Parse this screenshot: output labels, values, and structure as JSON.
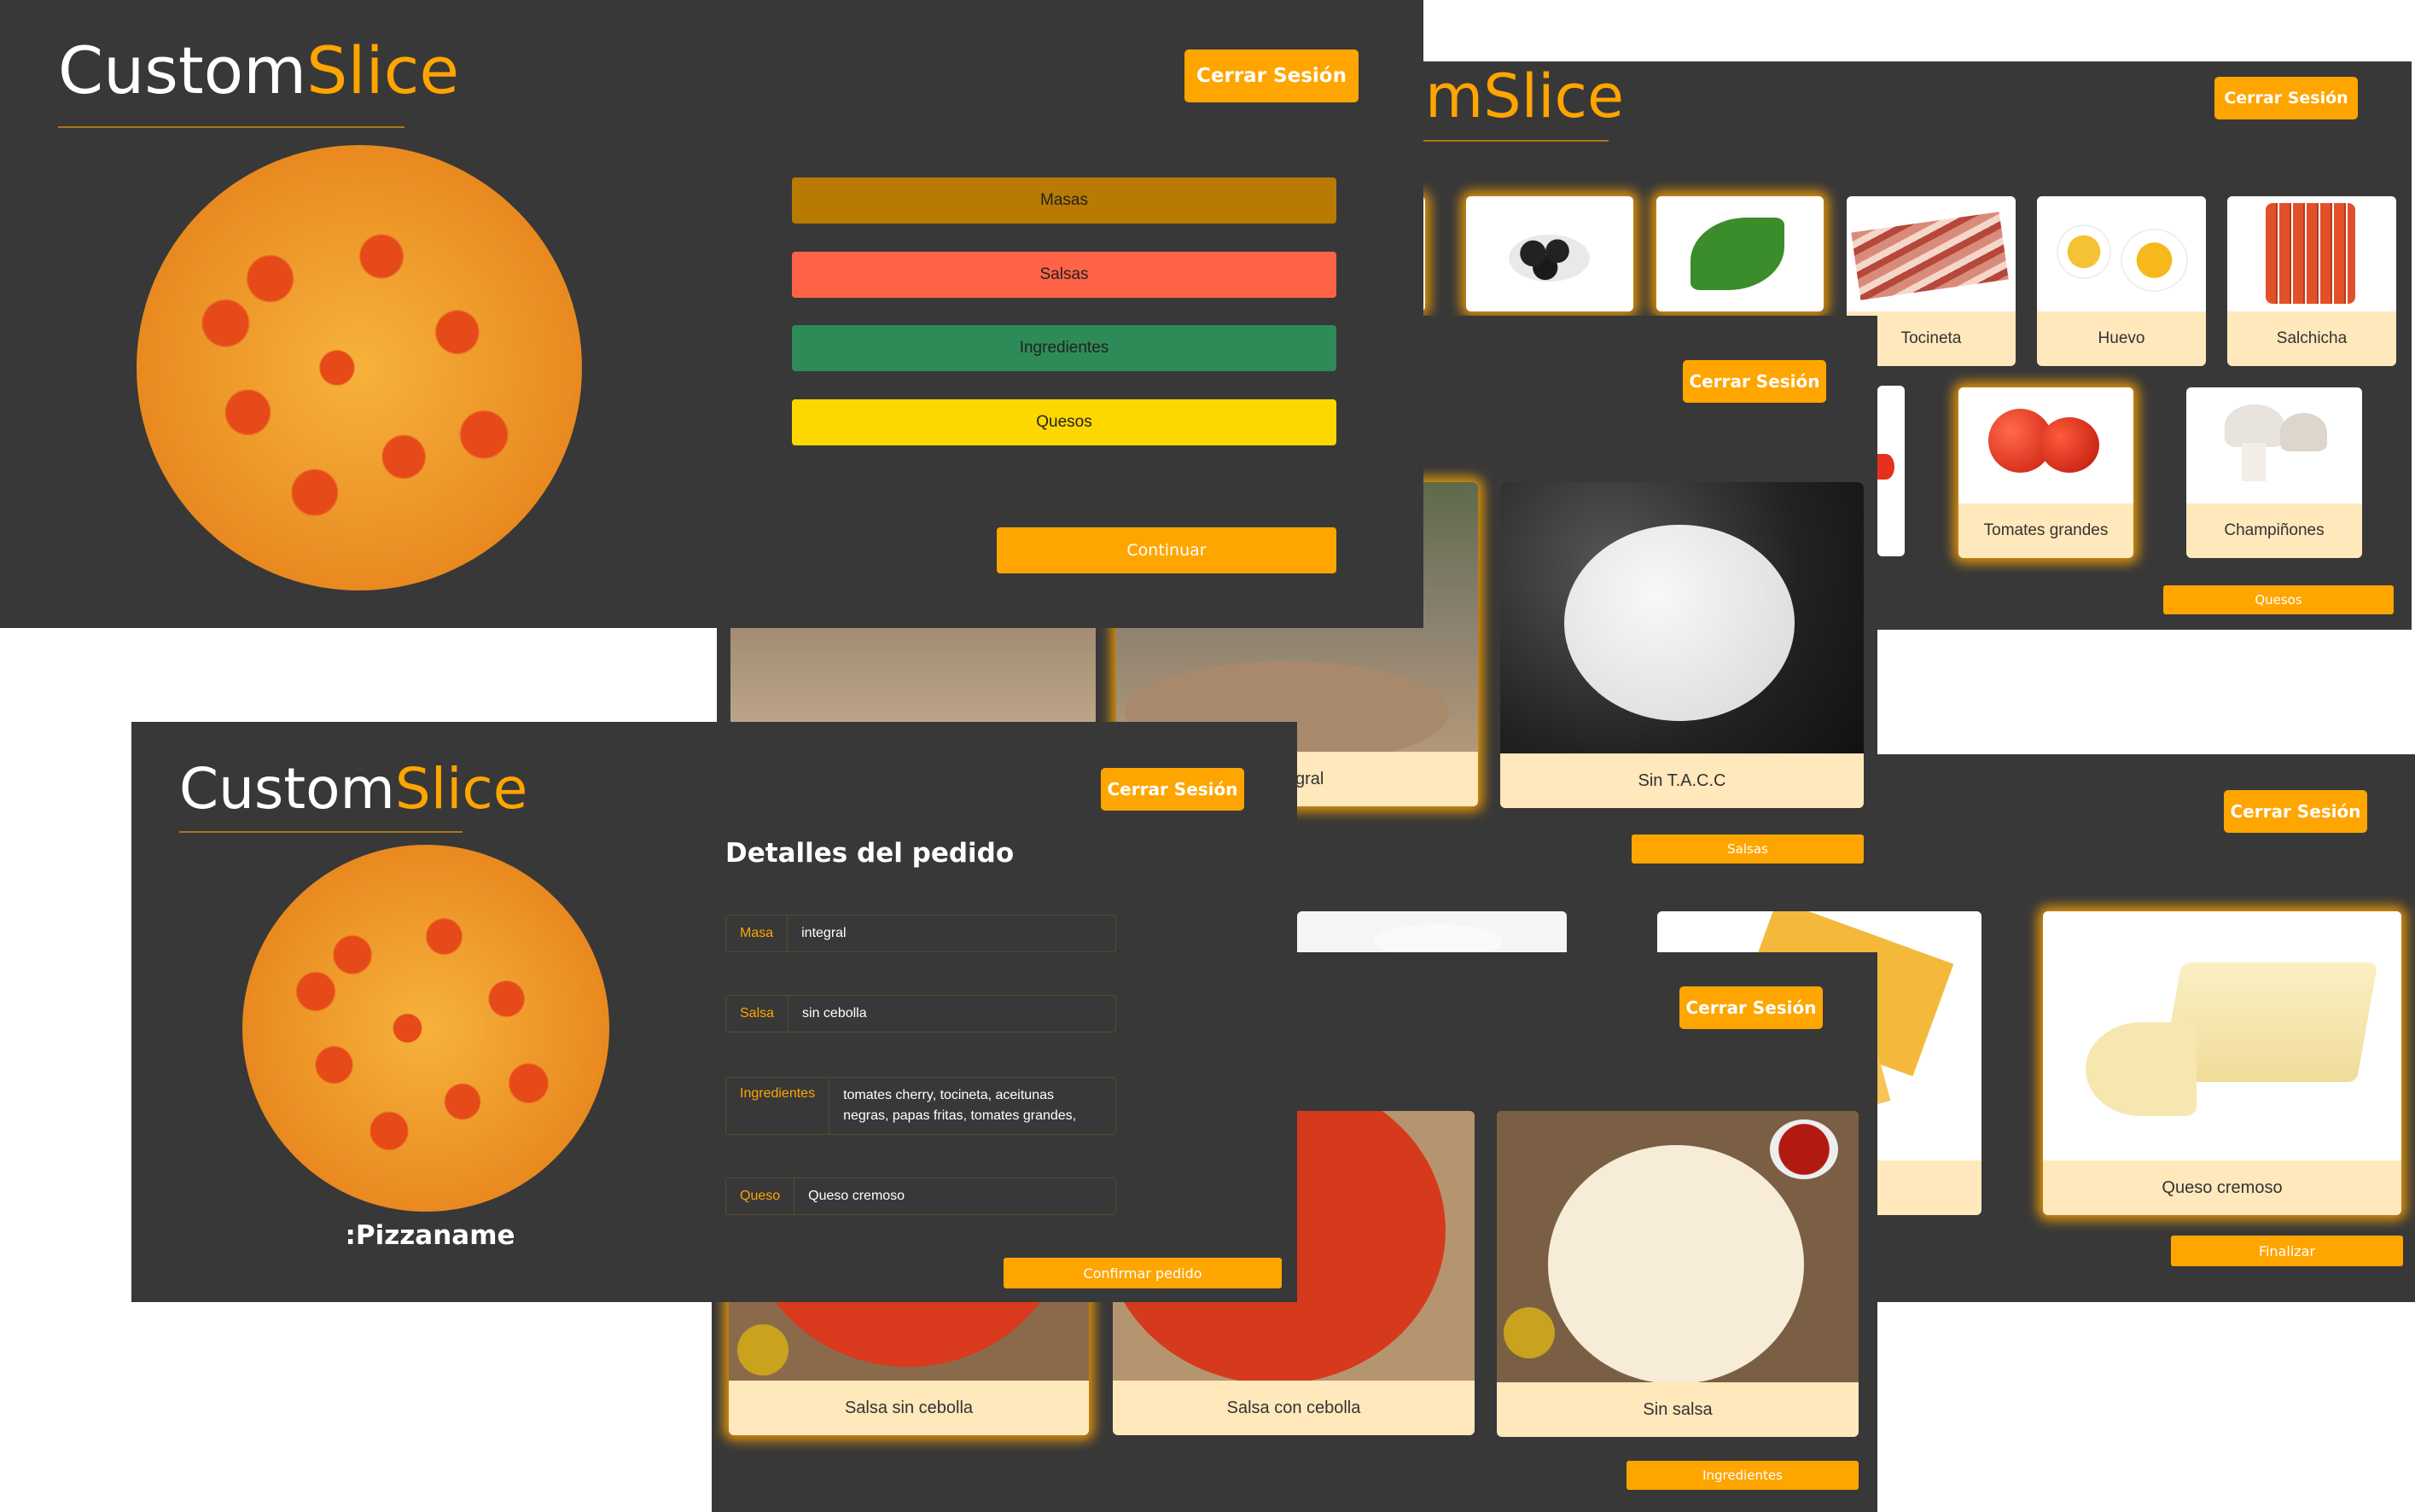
{
  "brand": {
    "part1": "Custom",
    "part2": "Slice",
    "part2_cut": "mSlice"
  },
  "common": {
    "logout_label": "Cerrar Sesión"
  },
  "ingredients_screen": {
    "items": [
      "Tocineta",
      "Huevo",
      "Salchicha",
      "Tomates grandes",
      "Champiñones"
    ],
    "next_label": "Quesos"
  },
  "home_screen": {
    "categories": [
      "Masas",
      "Salsas",
      "Ingredientes",
      "Quesos"
    ],
    "continue_label": "Continuar",
    "colors": {
      "masas": "#b87a00",
      "salsas": "#ff6347",
      "ingredientes": "#2e8b57",
      "quesos": "#ffd700"
    }
  },
  "dough_screen": {
    "items": [
      "gral",
      "Sin T.A.C.C"
    ],
    "next_label": "Salsas"
  },
  "cheese_screen": {
    "items": [
      "Queso cremoso"
    ],
    "next_label": "Finalizar"
  },
  "sauce_screen": {
    "items": [
      "Salsa sin cebolla",
      "Salsa con cebolla",
      "Sin salsa"
    ],
    "next_label": "Ingredientes"
  },
  "order_screen": {
    "title": "Detalles del pedido",
    "pizza_name": ":Pizzaname",
    "fields": [
      {
        "key": "Masa",
        "value": "integral"
      },
      {
        "key": "Salsa",
        "value": "sin cebolla"
      },
      {
        "key": "Ingredientes",
        "value": "tomates cherry, tocineta, aceitunas negras, papas fritas, tomates grandes,"
      },
      {
        "key": "Queso",
        "value": "Queso cremoso"
      }
    ],
    "confirm_label": "Confirmar pedido"
  },
  "accent_color": "#ffa500"
}
